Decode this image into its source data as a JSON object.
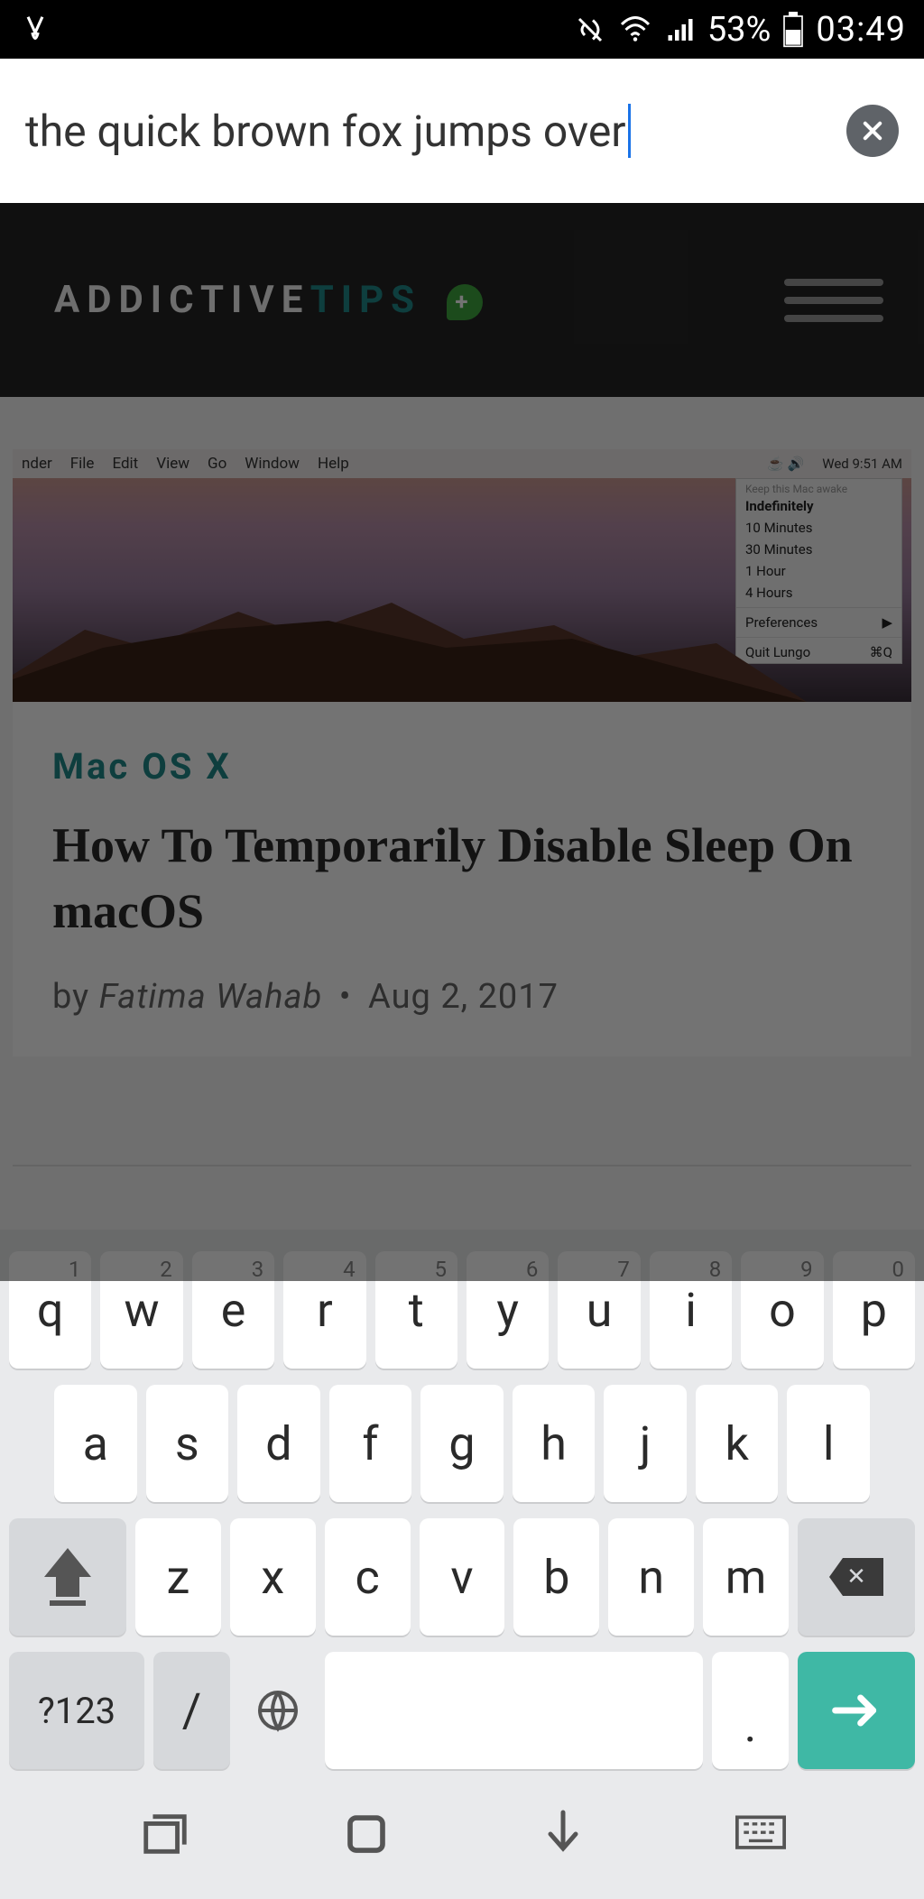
{
  "status": {
    "battery": "53%",
    "time": "03:49"
  },
  "urlbar": {
    "value": "the quick brown fox jumps over"
  },
  "page": {
    "site_name_main": "ADDICTIVE",
    "site_name_accent": "TIPS",
    "macmenu": {
      "items": [
        "nder",
        "File",
        "Edit",
        "View",
        "Go",
        "Window",
        "Help"
      ],
      "clock": "Wed 9:51 AM",
      "dropdown_header": "Keep this Mac awake",
      "dropdown_items": [
        "Indefinitely",
        "10 Minutes",
        "30 Minutes",
        "1 Hour",
        "4 Hours"
      ],
      "prefs": "Preferences",
      "quit": "Quit Lungo",
      "quit_shortcut": "⌘Q"
    },
    "article": {
      "category": "Mac OS X",
      "title": "How To Temporarily Disable Sleep On macOS",
      "by_label": "by",
      "author": "Fatima Wahab",
      "date": "Aug 2, 2017"
    }
  },
  "keyboard": {
    "row1": [
      {
        "k": "q",
        "s": "1"
      },
      {
        "k": "w",
        "s": "2"
      },
      {
        "k": "e",
        "s": "3"
      },
      {
        "k": "r",
        "s": "4"
      },
      {
        "k": "t",
        "s": "5"
      },
      {
        "k": "y",
        "s": "6"
      },
      {
        "k": "u",
        "s": "7"
      },
      {
        "k": "i",
        "s": "8"
      },
      {
        "k": "o",
        "s": "9"
      },
      {
        "k": "p",
        "s": "0"
      }
    ],
    "row2": [
      "a",
      "s",
      "d",
      "f",
      "g",
      "h",
      "j",
      "k",
      "l"
    ],
    "row3": [
      "z",
      "x",
      "c",
      "v",
      "b",
      "n",
      "m"
    ],
    "sym_label": "?123",
    "slash_label": "/",
    "dot_label": "."
  }
}
